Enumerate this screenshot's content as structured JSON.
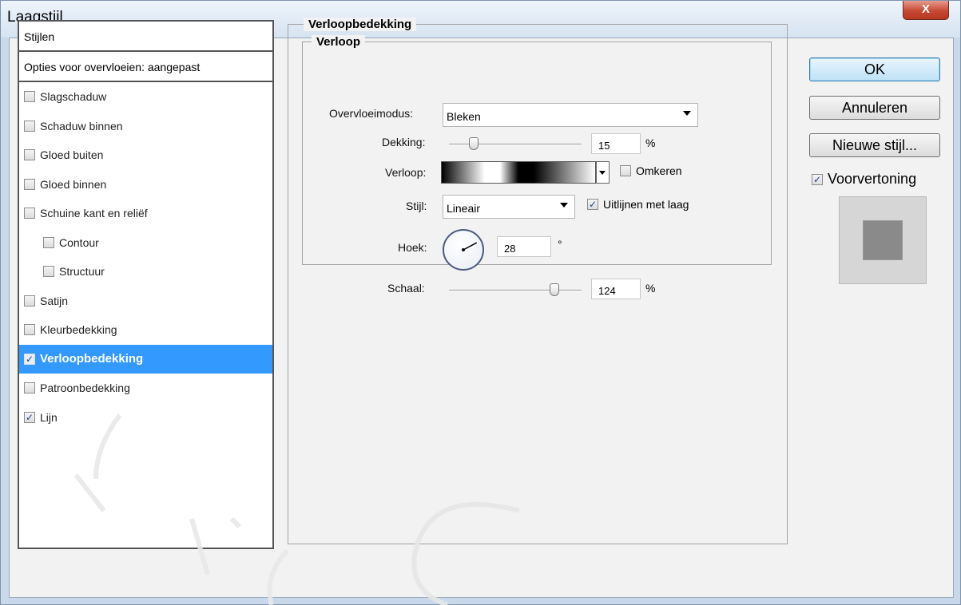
{
  "window": {
    "title": "Laagstijl",
    "close_label": "X"
  },
  "styles_panel": {
    "header": "Stijlen",
    "blend_options": "Opties voor overvloeien: aangepast",
    "items": [
      {
        "label": "Slagschaduw",
        "checked": false,
        "indent": false,
        "selected": false
      },
      {
        "label": "Schaduw binnen",
        "checked": false,
        "indent": false,
        "selected": false
      },
      {
        "label": "Gloed buiten",
        "checked": false,
        "indent": false,
        "selected": false
      },
      {
        "label": "Gloed binnen",
        "checked": false,
        "indent": false,
        "selected": false
      },
      {
        "label": "Schuine kant en reliëf",
        "checked": false,
        "indent": false,
        "selected": false
      },
      {
        "label": "Contour",
        "checked": false,
        "indent": true,
        "selected": false
      },
      {
        "label": "Structuur",
        "checked": false,
        "indent": true,
        "selected": false
      },
      {
        "label": "Satijn",
        "checked": false,
        "indent": false,
        "selected": false
      },
      {
        "label": "Kleurbedekking",
        "checked": false,
        "indent": false,
        "selected": false
      },
      {
        "label": "Verloopbedekking",
        "checked": true,
        "indent": false,
        "selected": true
      },
      {
        "label": "Patroonbedekking",
        "checked": false,
        "indent": false,
        "selected": false
      },
      {
        "label": "Lijn",
        "checked": true,
        "indent": false,
        "selected": false
      }
    ]
  },
  "overlay": {
    "group_title": "Verloopbedekking",
    "subgroup_title": "Verloop",
    "blend_mode_label": "Overvloeimodus:",
    "blend_mode_value": "Bleken",
    "opacity_label": "Dekking:",
    "opacity_value": "15",
    "opacity_unit": "%",
    "opacity_fraction": 0.15,
    "gradient_label": "Verloop:",
    "reverse_label": "Omkeren",
    "reverse_checked": false,
    "style_label": "Stijl:",
    "style_value": "Lineair",
    "align_label": "Uitlijnen met laag",
    "align_checked": true,
    "angle_label": "Hoek:",
    "angle_value": "28",
    "angle_unit": "°",
    "angle_degrees": 28,
    "scale_label": "Schaal:",
    "scale_value": "124",
    "scale_unit": "%"
  },
  "buttons": {
    "ok": "OK",
    "cancel": "Annuleren",
    "new_style": "Nieuwe stijl..."
  },
  "preview": {
    "label": "Voorvertoning",
    "checked": true
  },
  "colors": {
    "selection": "#3399ff",
    "check_mark": "#1d3f8a"
  }
}
